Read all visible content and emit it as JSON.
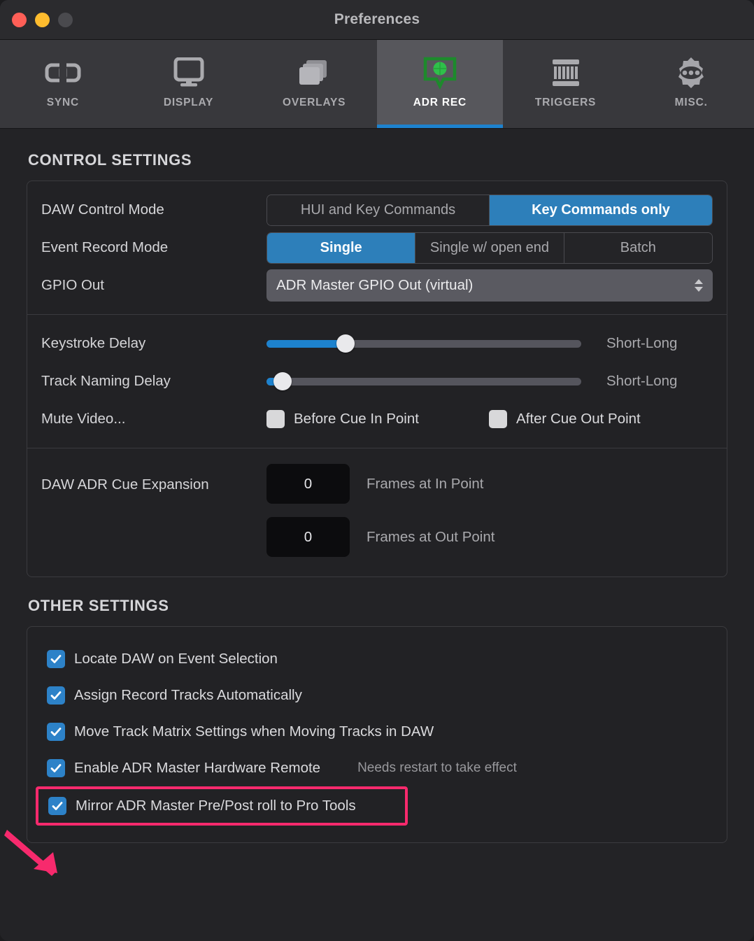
{
  "window": {
    "title": "Preferences",
    "traffic_lights": [
      "close",
      "minimize",
      "zoom"
    ]
  },
  "toolbar": {
    "tabs": [
      {
        "label": "SYNC",
        "icon": "link-icon",
        "active": false
      },
      {
        "label": "DISPLAY",
        "icon": "monitor-icon",
        "active": false
      },
      {
        "label": "OVERLAYS",
        "icon": "layers-icon",
        "active": false
      },
      {
        "label": "ADR REC",
        "icon": "adr-cue-icon",
        "active": true
      },
      {
        "label": "TRIGGERS",
        "icon": "midi-icon",
        "active": false
      },
      {
        "label": "MISC.",
        "icon": "gear-icon",
        "active": false
      }
    ]
  },
  "control_settings": {
    "heading": "CONTROL SETTINGS",
    "daw_control_mode": {
      "label": "DAW Control Mode",
      "options": [
        "HUI and Key Commands",
        "Key Commands only"
      ],
      "selected": "Key Commands only"
    },
    "event_record_mode": {
      "label": "Event Record Mode",
      "options": [
        "Single",
        "Single w/ open end",
        "Batch"
      ],
      "selected": "Single"
    },
    "gpio_out": {
      "label": "GPIO Out",
      "value": "ADR Master GPIO Out (virtual)"
    },
    "keystroke_delay": {
      "label": "Keystroke Delay",
      "caption": "Short-Long",
      "percent": 25
    },
    "track_naming_delay": {
      "label": "Track Naming Delay",
      "caption": "Short-Long",
      "percent": 5
    },
    "mute_video": {
      "label": "Mute Video...",
      "options": [
        {
          "label": "Before Cue In Point",
          "checked": false
        },
        {
          "label": "After Cue Out Point",
          "checked": false
        }
      ]
    },
    "cue_expansion": {
      "label": "DAW ADR Cue Expansion",
      "fields": [
        {
          "value": "0",
          "caption": "Frames at In Point"
        },
        {
          "value": "0",
          "caption": "Frames at Out Point"
        }
      ]
    }
  },
  "other_settings": {
    "heading": "OTHER SETTINGS",
    "options": [
      {
        "label": "Locate DAW on Event Selection",
        "checked": true,
        "note": ""
      },
      {
        "label": "Assign Record Tracks Automatically",
        "checked": true,
        "note": ""
      },
      {
        "label": "Move Track Matrix Settings when Moving Tracks in DAW",
        "checked": true,
        "note": ""
      },
      {
        "label": "Enable ADR Master Hardware Remote",
        "checked": true,
        "note": "Needs restart to take effect"
      },
      {
        "label": "Mirror ADR Master Pre/Post roll to Pro Tools",
        "checked": true,
        "note": ""
      }
    ]
  },
  "annotation": {
    "highlight_color": "#f72a6d",
    "arrow_color": "#f72a6d",
    "target_option": "Mirror ADR Master Pre/Post roll to Pro Tools"
  },
  "colors": {
    "accent_blue": "#1d82ce",
    "segment_selected": "#2d7fba",
    "checkbox_on": "#2d82c8",
    "rec_green": "#1d8a2c",
    "window_bg": "#232326",
    "toolbar_bg": "#38383c"
  }
}
